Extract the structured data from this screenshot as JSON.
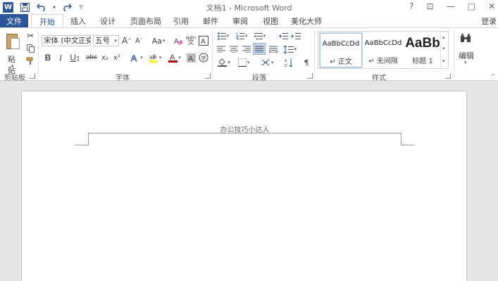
{
  "app": {
    "title": "文档1 - Microsoft Word",
    "logo_letter": "W",
    "quick_access": [
      {
        "name": "save-icon",
        "glyph": "💾"
      },
      {
        "name": "undo-icon",
        "glyph": "↶"
      },
      {
        "name": "redo-icon",
        "glyph": "↷"
      }
    ],
    "window_controls": [
      {
        "name": "help-icon",
        "glyph": "?"
      },
      {
        "name": "ribbon-display-icon",
        "glyph": "⊡"
      },
      {
        "name": "minimize-icon",
        "glyph": "—"
      },
      {
        "name": "maximize-icon",
        "glyph": "□"
      },
      {
        "name": "close-icon",
        "glyph": "✕"
      }
    ],
    "sign_in": "登录"
  },
  "tabs": {
    "file": "文件",
    "items": [
      "开始",
      "插入",
      "设计",
      "页面布局",
      "引用",
      "邮件",
      "审阅",
      "视图",
      "美化大师"
    ],
    "active_index": 0
  },
  "ribbon": {
    "clipboard": {
      "label": "剪贴板",
      "paste_label": "粘贴"
    },
    "font": {
      "label": "字体",
      "font_name": "宋体 (中文正文",
      "font_size": "五号",
      "bold": "B",
      "italic": "I",
      "underline": "U",
      "strike": "abc",
      "subscript": "x₂",
      "superscript": "x²",
      "grow": "A",
      "shrink": "A",
      "change_case": "Aa",
      "font_color": "A",
      "char_shading": "A"
    },
    "paragraph": {
      "label": "段落"
    },
    "styles": {
      "label": "样式",
      "items": [
        {
          "sample": "AaBbCcDd",
          "name": "↵ 正文"
        },
        {
          "sample": "AaBbCcDd",
          "name": "↵ 无间隔"
        },
        {
          "sample": "AaBb",
          "name": "标题 1"
        }
      ]
    },
    "editing": {
      "label": "编辑"
    }
  },
  "document": {
    "header_text": "办公技巧小达人"
  },
  "colors": {
    "accent": "#2b579a",
    "highlight": "#ffff00",
    "font_red": "#c00000"
  }
}
